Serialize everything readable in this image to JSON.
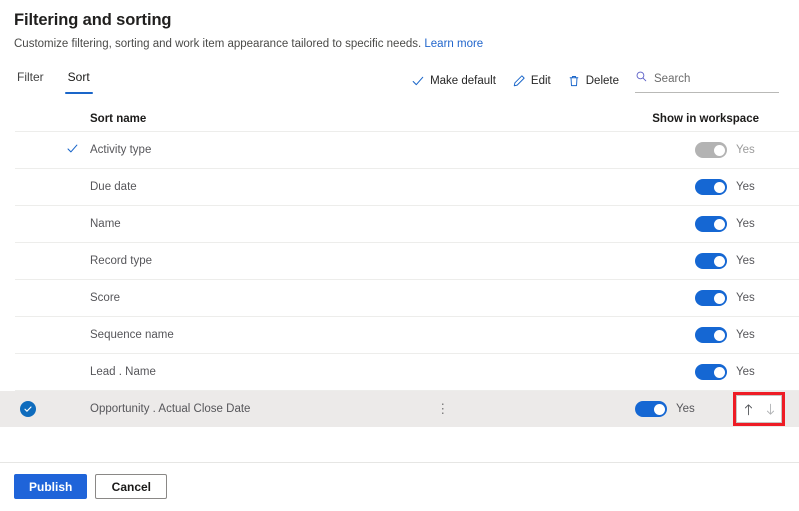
{
  "header": {
    "title": "Filtering and sorting",
    "subtitle": "Customize filtering, sorting and work item appearance tailored to specific needs.",
    "learn_more": "Learn more"
  },
  "tabs": [
    {
      "label": "Filter",
      "active": false
    },
    {
      "label": "Sort",
      "active": true
    }
  ],
  "commands": {
    "make_default": "Make default",
    "edit": "Edit",
    "delete": "Delete"
  },
  "search": {
    "placeholder": "Search",
    "value": ""
  },
  "table": {
    "columns": {
      "sort_name": "Sort name",
      "show_in_workspace": "Show in workspace"
    },
    "rows": [
      {
        "name": "Activity type",
        "default": true,
        "selected": false,
        "toggle_on": false,
        "toggle_disabled": true,
        "toggle_label": "Yes"
      },
      {
        "name": "Due date",
        "default": false,
        "selected": false,
        "toggle_on": true,
        "toggle_disabled": false,
        "toggle_label": "Yes"
      },
      {
        "name": "Name",
        "default": false,
        "selected": false,
        "toggle_on": true,
        "toggle_disabled": false,
        "toggle_label": "Yes"
      },
      {
        "name": "Record type",
        "default": false,
        "selected": false,
        "toggle_on": true,
        "toggle_disabled": false,
        "toggle_label": "Yes"
      },
      {
        "name": "Score",
        "default": false,
        "selected": false,
        "toggle_on": true,
        "toggle_disabled": false,
        "toggle_label": "Yes"
      },
      {
        "name": "Sequence name",
        "default": false,
        "selected": false,
        "toggle_on": true,
        "toggle_disabled": false,
        "toggle_label": "Yes"
      },
      {
        "name": "Lead . Name",
        "default": false,
        "selected": false,
        "toggle_on": true,
        "toggle_disabled": false,
        "toggle_label": "Yes"
      },
      {
        "name": "Opportunity . Actual Close Date",
        "default": false,
        "selected": true,
        "toggle_on": true,
        "toggle_disabled": false,
        "toggle_label": "Yes",
        "overflow": "⋮",
        "move_up": "↑",
        "move_down": "↓"
      }
    ]
  },
  "footer": {
    "publish": "Publish",
    "cancel": "Cancel"
  },
  "colors": {
    "accent": "#1a66c9",
    "toggle_on": "#1567d3",
    "toggle_off": "#b3b3b3",
    "primary_button": "#1f64d9",
    "selected_row": "#eceae9",
    "annotation": "#ee1c25",
    "link": "#2266cc"
  }
}
